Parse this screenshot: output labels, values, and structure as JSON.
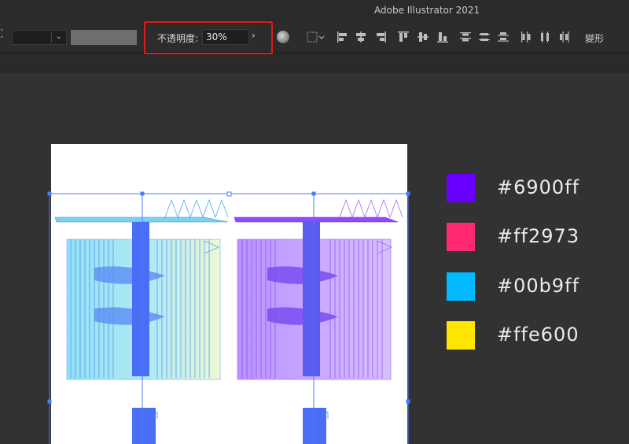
{
  "window": {
    "title": "Adobe Illustrator 2021"
  },
  "control_bar": {
    "opacity": {
      "label": "不透明度:",
      "value": "30%",
      "arrow": "›"
    },
    "stepper": {
      "up": "˄",
      "down": "˅"
    },
    "stroke_dropdown_chevron": "⌄",
    "transform_label": "變形",
    "icons": [
      "recolor-artwork-icon",
      "align-to-selection-icon",
      "align-left-icon",
      "align-horizontal-center-icon",
      "align-right-icon",
      "align-top-icon",
      "align-vertical-center-icon",
      "align-bottom-icon",
      "distribute-top-icon",
      "distribute-vertical-center-icon",
      "distribute-bottom-icon",
      "distribute-left-icon",
      "distribute-horizontal-center-icon",
      "distribute-right-icon"
    ]
  },
  "legend": [
    {
      "color": "#6900ff",
      "hex_label": "#6900ff"
    },
    {
      "color": "#ff2973",
      "hex_label": "#ff2973"
    },
    {
      "color": "#00b9ff",
      "hex_label": "#00b9ff"
    },
    {
      "color": "#ffe600",
      "hex_label": "#ffe600"
    }
  ],
  "colors": {
    "highlight": "#e0191b",
    "selection": "#4a7cff"
  }
}
